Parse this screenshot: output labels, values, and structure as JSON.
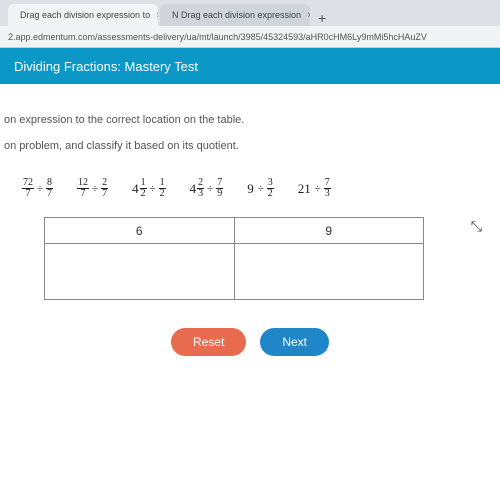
{
  "browser": {
    "tabs": [
      {
        "label": "Drag each division expression to",
        "icon_color": "#3aa3d8"
      },
      {
        "label": "N Drag each division expression",
        "icon_color": "#222"
      }
    ],
    "url": "2.app.edmentum.com/assessments-delivery/ua/mt/launch/3985/45324593/aHR0cHM6Ly9mMi5hcHAuZV"
  },
  "header": {
    "title": "Dividing Fractions: Mastery Test"
  },
  "instructions": {
    "line1": "on expression to the correct location on the table.",
    "line2": "on problem, and classify it based on its quotient."
  },
  "tiles": [
    {
      "lhs_whole": "",
      "lhs_n": "72",
      "lhs_d": "7",
      "op": "÷",
      "rhs_whole": "",
      "rhs_n": "8",
      "rhs_d": "7"
    },
    {
      "lhs_whole": "",
      "lhs_n": "12",
      "lhs_d": "7",
      "op": "÷",
      "rhs_whole": "",
      "rhs_n": "2",
      "rhs_d": "7"
    },
    {
      "lhs_whole": "4",
      "lhs_n": "1",
      "lhs_d": "2",
      "op": "÷",
      "rhs_whole": "",
      "rhs_n": "1",
      "rhs_d": "2"
    },
    {
      "lhs_whole": "4",
      "lhs_n": "2",
      "lhs_d": "3",
      "op": "÷",
      "rhs_whole": "",
      "rhs_n": "7",
      "rhs_d": "9"
    },
    {
      "lhs_whole": "9",
      "lhs_n": "",
      "lhs_d": "",
      "op": "÷",
      "rhs_whole": "",
      "rhs_n": "3",
      "rhs_d": "2"
    },
    {
      "lhs_whole": "21",
      "lhs_n": "",
      "lhs_d": "",
      "op": "÷",
      "rhs_whole": "",
      "rhs_n": "7",
      "rhs_d": "3"
    }
  ],
  "table": {
    "headers": [
      "6",
      "9"
    ]
  },
  "buttons": {
    "reset": "Reset",
    "next": "Next"
  }
}
